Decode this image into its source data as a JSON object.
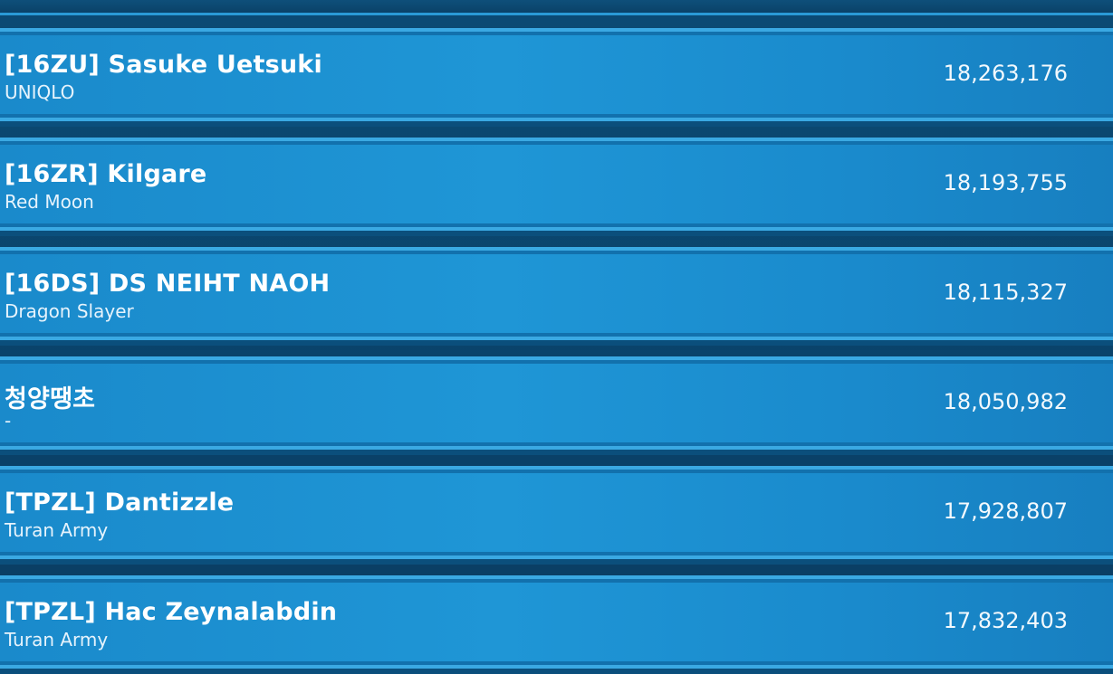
{
  "leaderboard": {
    "rows": [
      {
        "name": "[16ZU] Sasuke Uetsuki",
        "guild": "UNIQLO",
        "score": "18,263,176"
      },
      {
        "name": "[16ZR] Kilgare",
        "guild": "Red Moon",
        "score": "18,193,755"
      },
      {
        "name": "[16DS] DS NEIHT NAOH",
        "guild": "Dragon Slayer",
        "score": "18,115,327"
      },
      {
        "name": "청양땡초",
        "guild": "-",
        "score": "18,050,982"
      },
      {
        "name": "[TPZL] Dantizzle",
        "guild": "Turan Army",
        "score": "17,928,807"
      },
      {
        "name": "[TPZL] Hac Zeynalabdin",
        "guild": "Turan Army",
        "score": "17,832,403"
      }
    ]
  },
  "colors": {
    "row_fill": "#1f96d6",
    "row_border": "#3aa9e3",
    "background": "#0a3d62",
    "text": "#ffffff"
  }
}
